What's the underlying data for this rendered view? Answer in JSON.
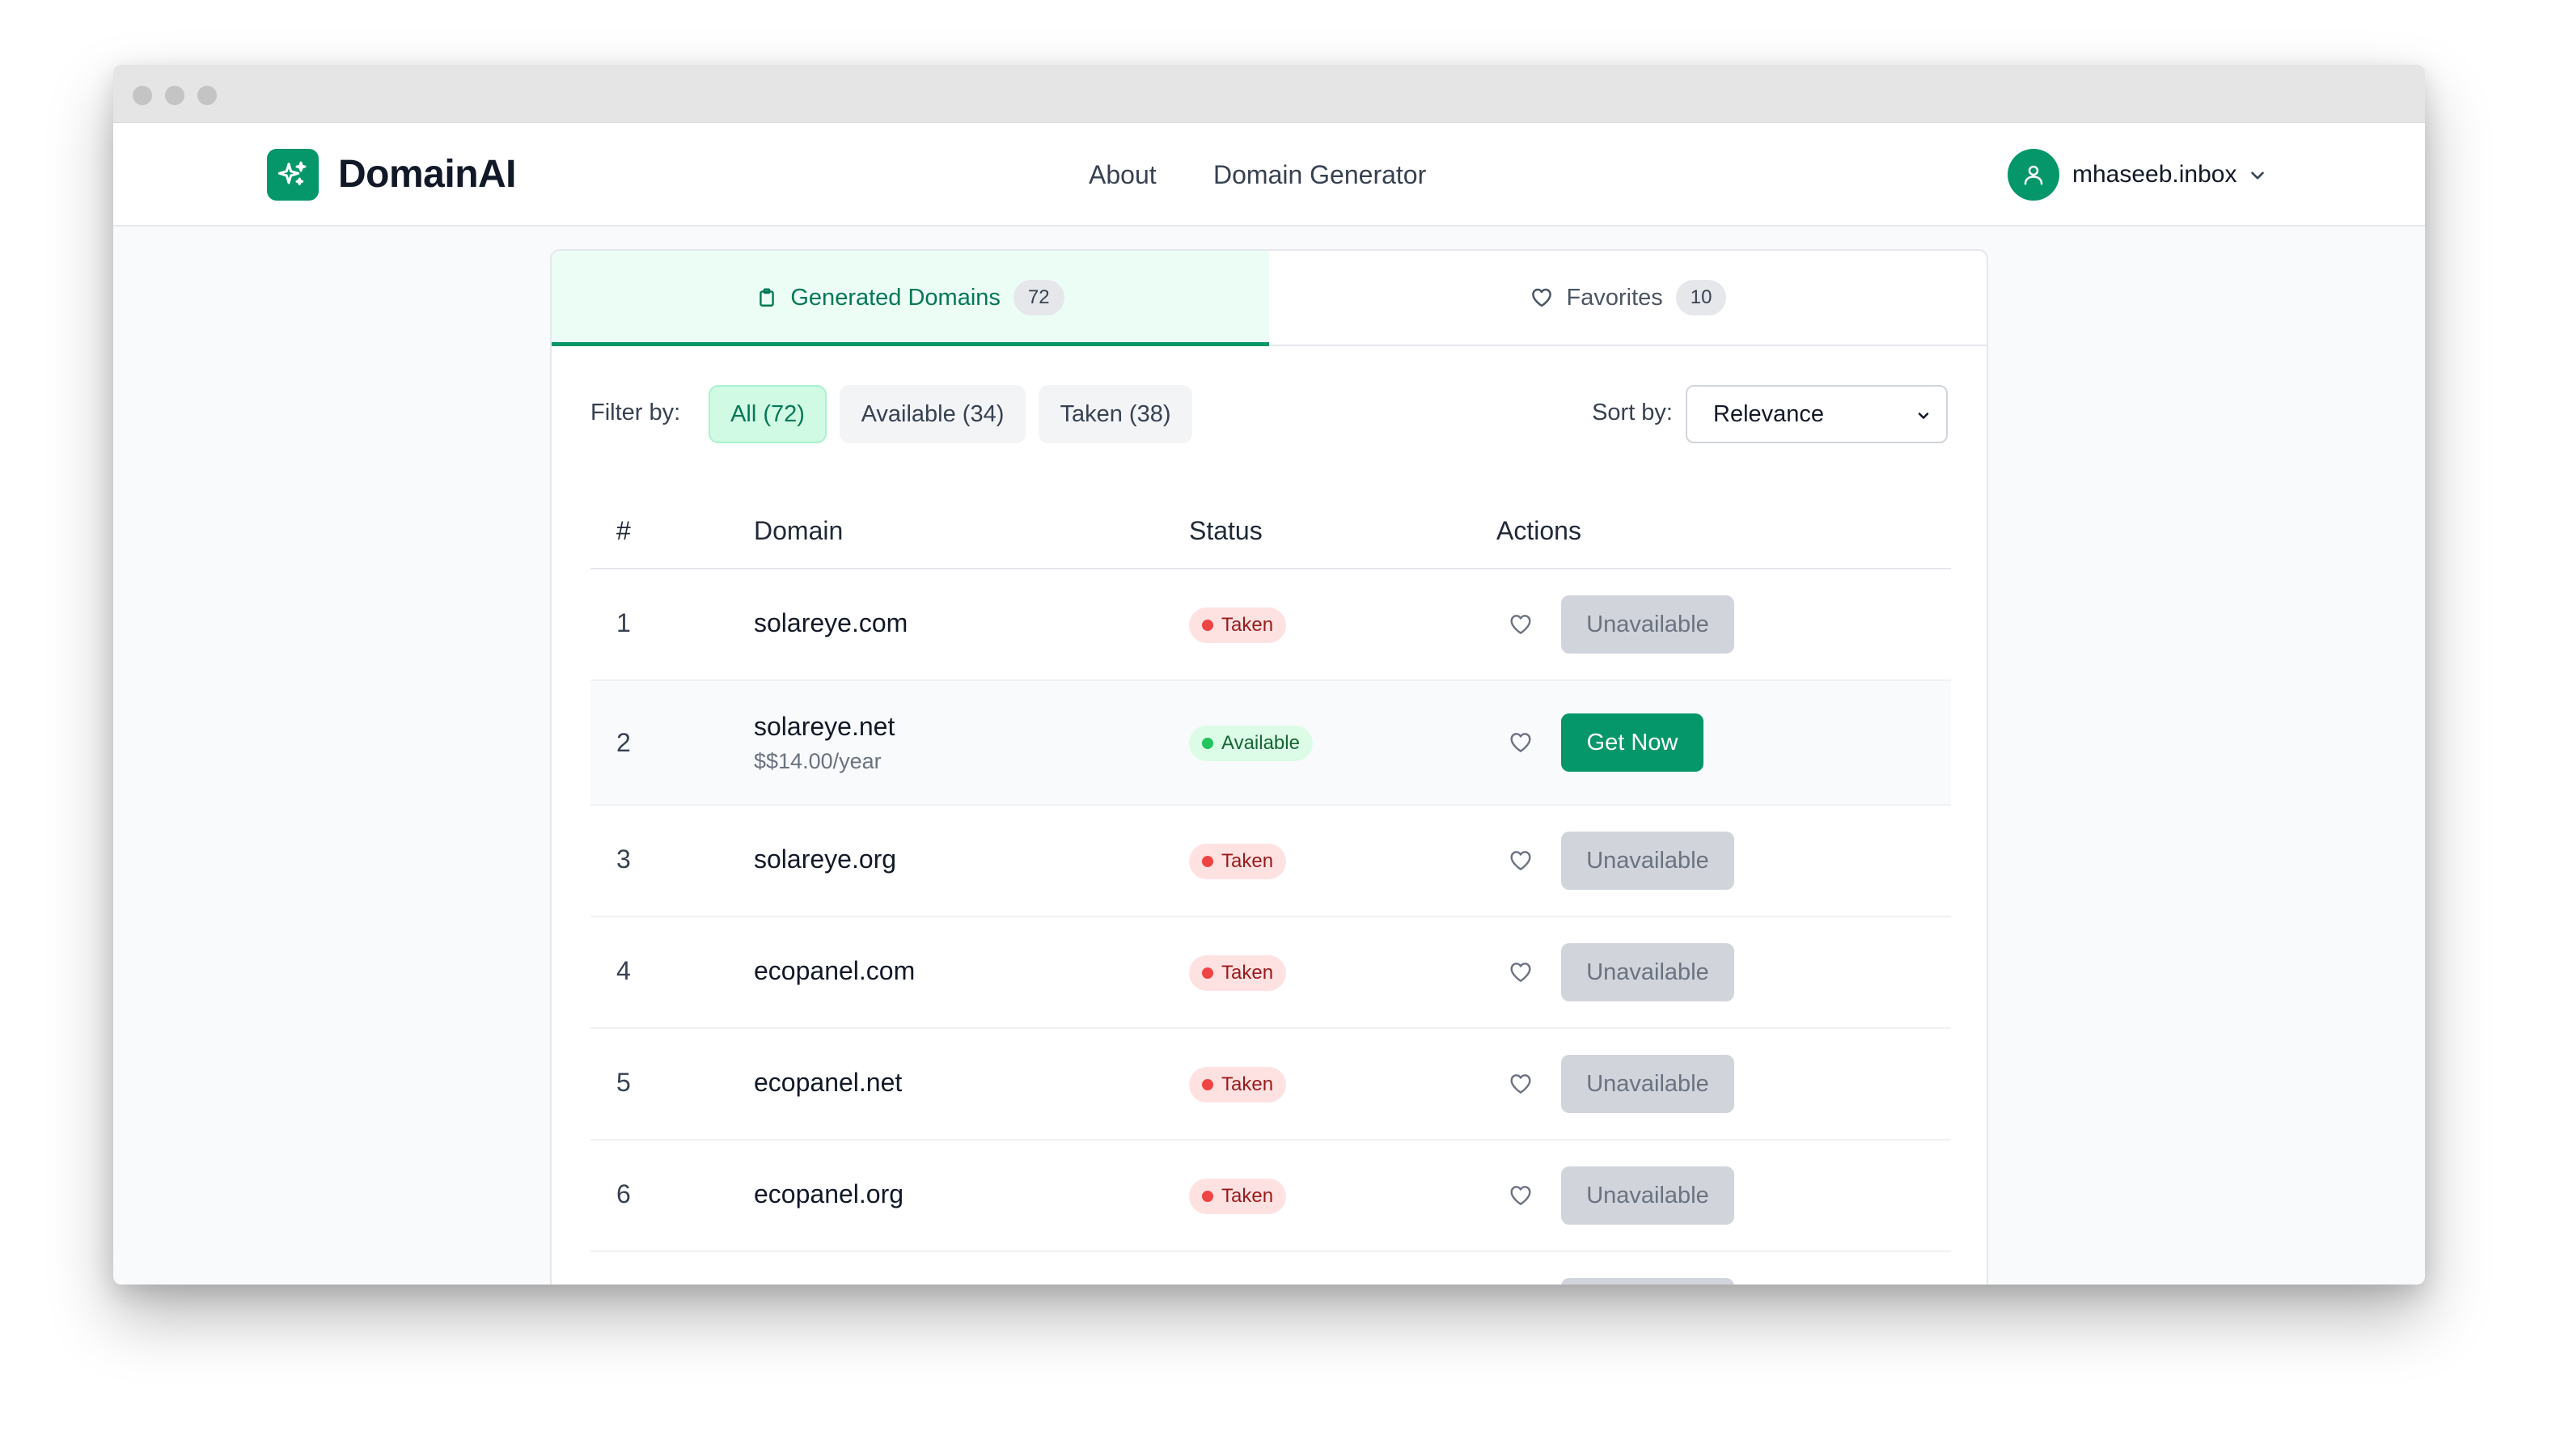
{
  "app": {
    "name": "DomainAI",
    "nav": [
      "About",
      "Domain Generator"
    ],
    "user": "mhaseeb.inbox"
  },
  "tabs": [
    {
      "label": "Generated Domains",
      "count": "72",
      "active": true
    },
    {
      "label": "Favorites",
      "count": "10",
      "active": false
    }
  ],
  "filters": {
    "label": "Filter by:",
    "chips": [
      "All (72)",
      "Available (34)",
      "Taken (38)"
    ],
    "active_index": 0
  },
  "sort": {
    "label": "Sort by:",
    "value": "Relevance"
  },
  "table": {
    "headers": [
      "#",
      "Domain",
      "Status",
      "Actions"
    ],
    "rows": [
      {
        "num": "1",
        "domain": "solareye.com",
        "price": "",
        "status": "Taken",
        "action": "Unavailable"
      },
      {
        "num": "2",
        "domain": "solareye.net",
        "price": "$$14.00/year",
        "status": "Available",
        "action": "Get Now"
      },
      {
        "num": "3",
        "domain": "solareye.org",
        "price": "",
        "status": "Taken",
        "action": "Unavailable"
      },
      {
        "num": "4",
        "domain": "ecopanel.com",
        "price": "",
        "status": "Taken",
        "action": "Unavailable"
      },
      {
        "num": "5",
        "domain": "ecopanel.net",
        "price": "",
        "status": "Taken",
        "action": "Unavailable"
      },
      {
        "num": "6",
        "domain": "ecopanel.org",
        "price": "",
        "status": "Taken",
        "action": "Unavailable"
      }
    ]
  },
  "icons": {
    "logo": "sparkles-icon",
    "user": "user-icon",
    "dropdown": "chevron-down-icon",
    "generated_tab": "clipboard-icon",
    "favorites_tab": "heart-icon",
    "favorite_action": "heart-icon"
  },
  "colors": {
    "brand": "#059669",
    "taken_bg": "#fee2e2",
    "taken_dot": "#ef4444",
    "available_bg": "#dcfce7",
    "available_dot": "#22c55e"
  }
}
